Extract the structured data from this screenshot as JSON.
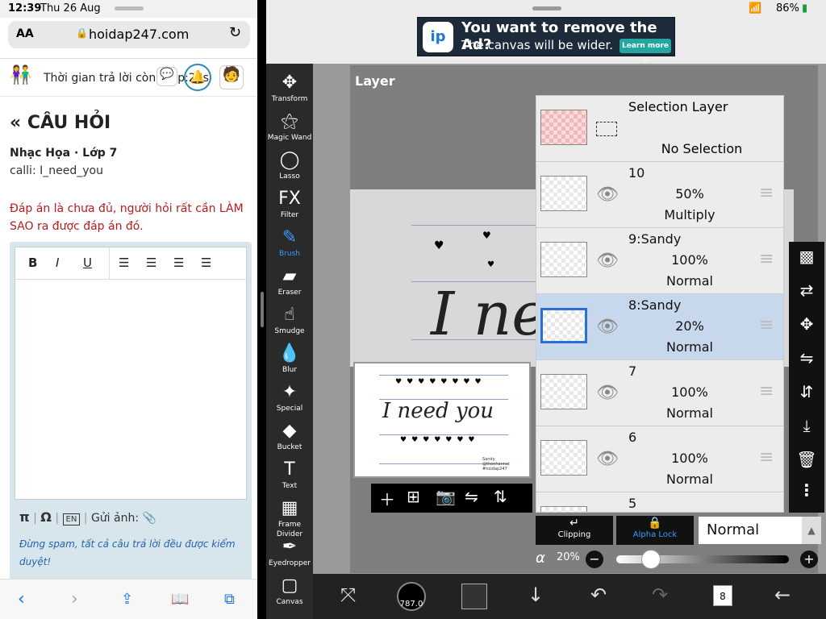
{
  "left_status": {
    "time": "12:39",
    "date": "Thu 26 Aug"
  },
  "browser": {
    "aa": "AA",
    "url": "hoidap247.com"
  },
  "site": {
    "timer_text": "Thời gian trả lời còn: 24p:26s"
  },
  "question": {
    "heading": "CÂU HỎI",
    "heading_icon": "«",
    "meta": "Nhạc Họa · Lớp 7",
    "text": "calli: I_need_you",
    "warning": "Đáp án là chưa đủ, người hỏi rất cần LÀM SAO ra được đáp án đó."
  },
  "editor": {
    "toolbar": [
      "B",
      "I",
      "U"
    ],
    "foot_upload": "Gửi ảnh:",
    "foot_en": "EN",
    "spam_note": "Đừng spam, tất cả câu trả lời đều được kiểm duyệt!"
  },
  "right_status": {
    "battery": "86%"
  },
  "ad": {
    "line1": "You want to remove the Ad?",
    "line2": "The canvas will be wider.",
    "learn_more": "Learn more ›"
  },
  "tools": [
    {
      "label": "Transform",
      "icon": "✥"
    },
    {
      "label": "Magic Wand",
      "icon": "⚝"
    },
    {
      "label": "Lasso",
      "icon": "◯"
    },
    {
      "label": "Filter",
      "icon": "FX"
    },
    {
      "label": "Brush",
      "icon": "✎",
      "active": true
    },
    {
      "label": "Eraser",
      "icon": "▰"
    },
    {
      "label": "Smudge",
      "icon": "☝"
    },
    {
      "label": "Blur",
      "icon": "💧"
    },
    {
      "label": "Special",
      "icon": "✦"
    },
    {
      "label": "Bucket",
      "icon": "◆"
    },
    {
      "label": "Text",
      "icon": "T"
    },
    {
      "label": "Frame Divider",
      "icon": "▦"
    },
    {
      "label": "Eyedropper",
      "icon": "✒"
    },
    {
      "label": "Canvas",
      "icon": "▢"
    }
  ],
  "layer_panel": {
    "title": "Layer",
    "preview_text": "I need you",
    "canvas_text": "I ne",
    "signature": [
      "Sandy",
      "@thonhannat",
      "#hoidap247"
    ],
    "selection_layer": {
      "name": "Selection Layer",
      "status": "No Selection"
    },
    "layers": [
      {
        "name": "10",
        "opacity": "50%",
        "blend": "Multiply",
        "selected": false
      },
      {
        "name": "9:Sandy",
        "opacity": "100%",
        "blend": "Normal",
        "selected": false
      },
      {
        "name": "8:Sandy",
        "opacity": "20%",
        "blend": "Normal",
        "selected": true
      },
      {
        "name": "7",
        "opacity": "100%",
        "blend": "Normal",
        "selected": false
      },
      {
        "name": "6",
        "opacity": "100%",
        "blend": "Normal",
        "selected": false
      },
      {
        "name": "5",
        "opacity": "",
        "blend": "",
        "selected": false
      }
    ],
    "clipping_label": "Clipping",
    "alpha_lock_label": "Alpha Lock",
    "blend_mode": "Normal",
    "alpha_symbol": "α",
    "alpha_value": "20%",
    "alpha_fraction": 0.2
  },
  "bottom_bar": {
    "brush_size": "787.0",
    "layers_count": "8"
  },
  "colors": {
    "accent": "#3a9cff",
    "selected_layer": "#c8d8ec",
    "ad_bg": "#1d2a39"
  }
}
